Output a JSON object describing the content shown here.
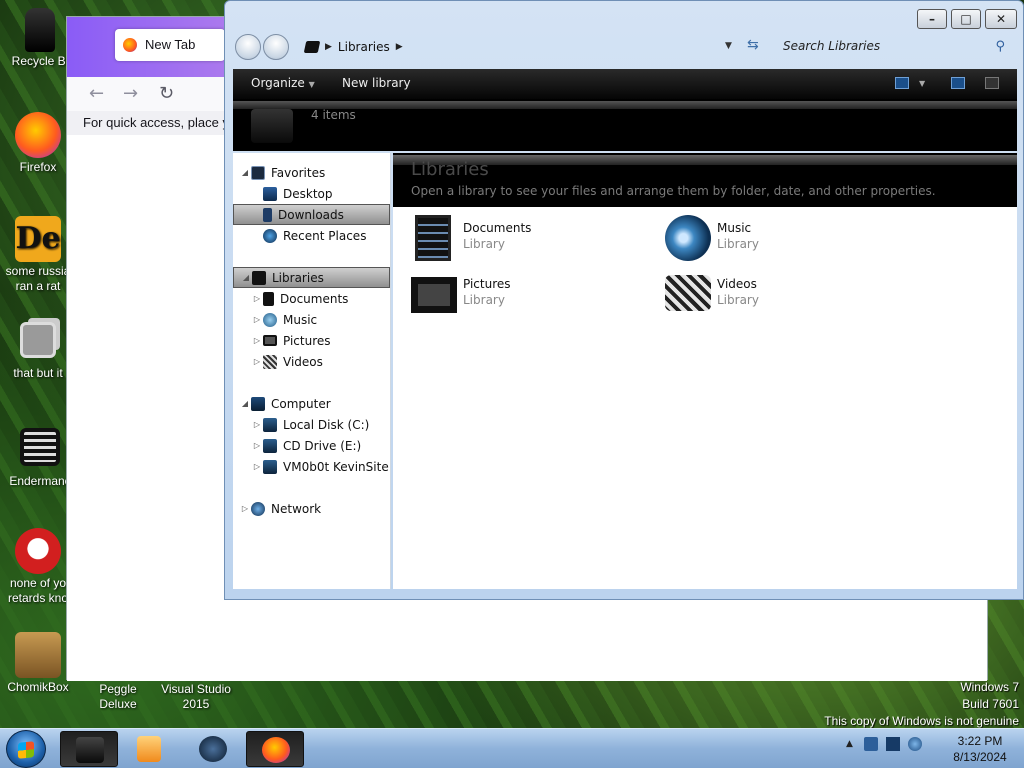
{
  "desktop": {
    "icons": [
      {
        "label": "Recycle Bi",
        "icon": "recycle-bin-icon"
      },
      {
        "label": "Firefox",
        "icon": "firefox-icon"
      },
      {
        "label": "some russia\nran a rat",
        "icon": "de-app-icon"
      },
      {
        "label": "that but it",
        "icon": "copy-stack-icon"
      },
      {
        "label": "Endermanc",
        "icon": "enderman-icon"
      },
      {
        "label": "none of yo\nretards kno",
        "icon": "red-dragon-icon"
      },
      {
        "label": "ChomikBox",
        "icon": "chomikbox-icon"
      }
    ],
    "bottom_labels": [
      "Peggle Deluxe",
      "Visual Studio\n2015"
    ]
  },
  "firefox": {
    "tab_title": "New Tab",
    "quick_access_text": "For quick access, place you"
  },
  "explorer": {
    "breadcrumb": "Libraries",
    "search_placeholder": "Search Libraries",
    "toolbar": {
      "organize": "Organize",
      "new_library": "New library"
    },
    "item_count": "4 items",
    "header_title": "Libraries",
    "header_subtitle": "Open a library to see your files and arrange them by folder, date, and other properties.",
    "nav": {
      "favorites": "Favorites",
      "desktop": "Desktop",
      "downloads": "Downloads",
      "recent": "Recent Places",
      "libraries": "Libraries",
      "documents": "Documents",
      "music": "Music",
      "pictures": "Pictures",
      "videos": "Videos",
      "computer": "Computer",
      "local_disk": "Local Disk (C:)",
      "cd_drive": "CD Drive (E:)",
      "vm_site": "VM0b0t KevinSite",
      "network": "Network"
    },
    "libraries": [
      {
        "name": "Documents",
        "type": "Library"
      },
      {
        "name": "Music",
        "type": "Library"
      },
      {
        "name": "Pictures",
        "type": "Library"
      },
      {
        "name": "Videos",
        "type": "Library"
      }
    ]
  },
  "watermark": {
    "line1": "Windows 7",
    "line2": "Build 7601",
    "line3": "This copy of Windows is not genuine"
  },
  "clock": {
    "time": "3:22 PM",
    "date": "8/13/2024"
  }
}
